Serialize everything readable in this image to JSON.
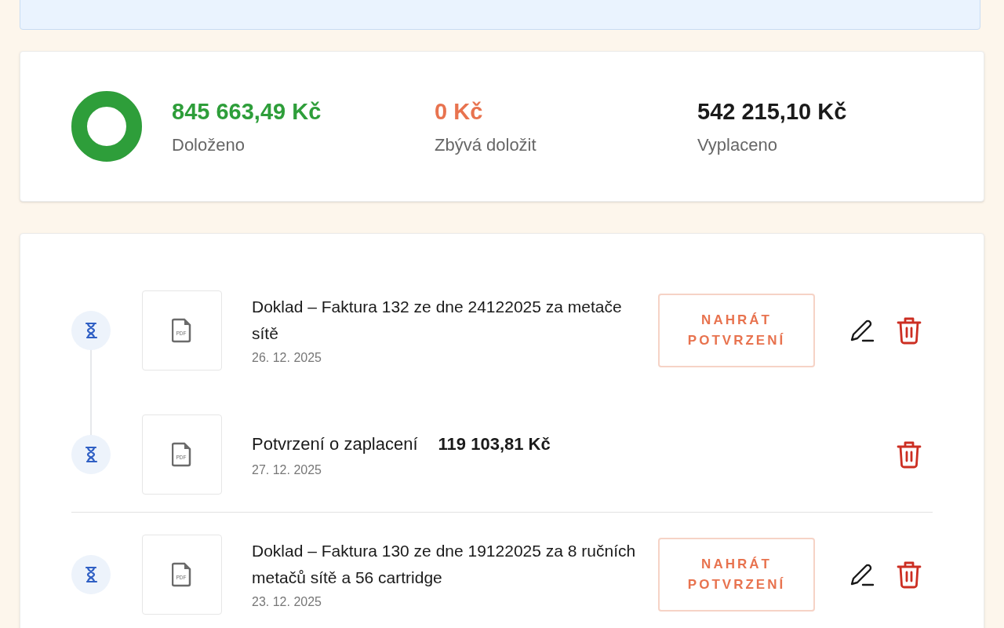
{
  "summary": {
    "donut": {
      "level": 1
    },
    "stats": [
      {
        "kind": "positive",
        "value": "845 663,49 Kč",
        "label": "Doloženo"
      },
      {
        "kind": "warning",
        "value": "0 Kč",
        "label": "Zbývá doložit"
      },
      {
        "kind": "neutral",
        "value": "542 215,10 Kč",
        "label": "Vyplaceno"
      }
    ]
  },
  "groups": [
    {
      "items": [
        {
          "kind": "invoice",
          "title": "Doklad – Faktura 132 ze dne 24122025 za metače sítě",
          "date": "26. 12. 2025",
          "action": "NAHRÁT POTVRZENÍ",
          "editable": true,
          "file_type": "PDF"
        },
        {
          "kind": "payment",
          "title": "Potvrzení o zaplacení",
          "amount": "119 103,81 Kč",
          "date": "27. 12. 2025",
          "editable": false,
          "file_type": "PDF"
        }
      ]
    },
    {
      "items": [
        {
          "kind": "invoice",
          "title": "Doklad – Faktura 130 ze dne 19122025 za 8 ručních metačů sítě a 56 cartridge",
          "date": "23. 12. 2025",
          "action": "NAHRÁT POTVRZENÍ",
          "editable": true,
          "file_type": "PDF"
        }
      ]
    }
  ]
}
